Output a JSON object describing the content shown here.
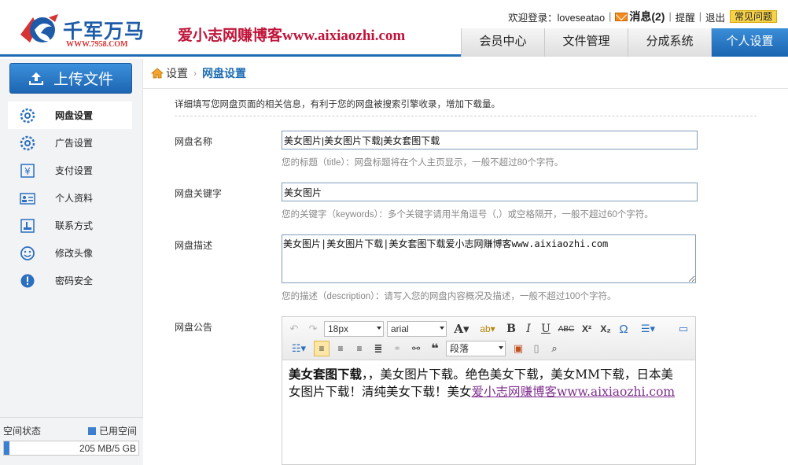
{
  "header": {
    "logo_text": "千军万马",
    "logo_sub": "WWW.7958.COM",
    "banner": "爱小志网赚博客www.aixiaozhi.com",
    "welcome": "欢迎登录：loveseatao",
    "messages": "消息(2)",
    "remind": "提醒",
    "logout": "退出",
    "faq": "常见问题",
    "tabs": [
      {
        "label": "会员中心",
        "active": false
      },
      {
        "label": "文件管理",
        "active": false
      },
      {
        "label": "分成系统",
        "active": false
      },
      {
        "label": "个人设置",
        "active": true
      }
    ]
  },
  "sidebar": {
    "upload_label": "上传文件",
    "items": [
      {
        "label": "网盘设置",
        "icon": "gear-icon",
        "active": true
      },
      {
        "label": "广告设置",
        "icon": "gear-icon",
        "active": false
      },
      {
        "label": "支付设置",
        "icon": "yen-icon",
        "active": false
      },
      {
        "label": "个人资料",
        "icon": "id-card-icon",
        "active": false
      },
      {
        "label": "联系方式",
        "icon": "contact-icon",
        "active": false
      },
      {
        "label": "修改头像",
        "icon": "smiley-icon",
        "active": false
      },
      {
        "label": "密码安全",
        "icon": "alert-icon",
        "active": false
      }
    ],
    "space": {
      "label": "空间状态",
      "legend": "已用空间",
      "usage_text": "205 MB/5 GB",
      "used_fraction": 0.04
    }
  },
  "breadcrumb": {
    "root": "设置",
    "arrow": "›",
    "current": "网盘设置"
  },
  "main": {
    "intro": "详细填写您网盘页面的相关信息，有利于您的网盘被搜索引擎收录，增加下载量。",
    "name": {
      "label": "网盘名称",
      "value": "美女图片|美女图片下载|美女套图下载",
      "hint": "您的标题（title）：网盘标题将在个人主页显示，一般不超过80个字符。"
    },
    "keywords": {
      "label": "网盘关键字",
      "value": "美女图片",
      "hint": "您的关键字（keywords）：多个关键字请用半角逗号（,）或空格隔开，一般不超过60个字符。"
    },
    "description": {
      "label": "网盘描述",
      "value": "美女图片|美女图片下载|美女套图下载爱小志网赚博客www.aixiaozhi.com",
      "hint": "您的描述（description）：请写入您的网盘内容概况及描述，一般不超过100个字符。"
    },
    "notice": {
      "label": "网盘公告",
      "font_size": "18px",
      "font_family": "arial",
      "paragraph": "段落",
      "content_bold": "美女套图下载",
      "content_text": "，，美女图片下载。绝色美女下载，美女MM下载，日本美女图片下载！清纯美女下载！美女",
      "content_link": "爱小志网赚博客www.aixiaozhi.com"
    }
  },
  "colors": {
    "brand_blue": "#1f6db3",
    "banner_red": "#c0143a",
    "link_purple": "#7e2e8e"
  }
}
